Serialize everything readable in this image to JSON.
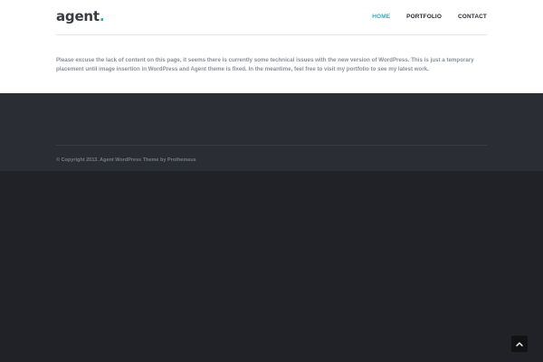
{
  "header": {
    "logo_text": "agent",
    "logo_dot": ".",
    "nav": [
      {
        "label": "HOME",
        "active": true
      },
      {
        "label": "PORTFOLIO",
        "active": false
      },
      {
        "label": "CONTACT",
        "active": false
      }
    ]
  },
  "content": {
    "notice": "Please excuse the lack of content on this page, it seems there is currently some technical issues with the new version of WordPress. This is just a temporary placement until image insertion in WordPress and Agent theme is fixed. In the meantime, feel free to visit my portfolio to see my latest work."
  },
  "footer": {
    "copyright": "© Copyright 2013. Agent WordPress Theme by Prothemeus"
  },
  "scroll_top": {
    "icon": "chevron-up-icon"
  },
  "colors": {
    "accent": "#3aa9b8",
    "footer_bg": "#2a2d33",
    "page_bg": "#212227"
  }
}
